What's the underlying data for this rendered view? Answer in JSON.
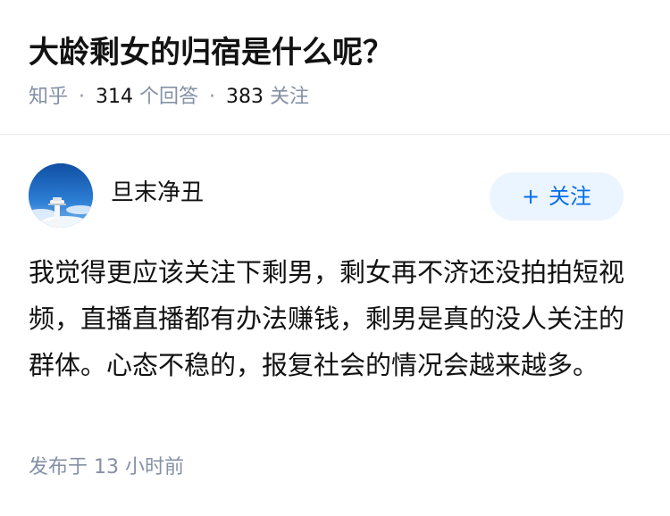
{
  "question": {
    "title": "大龄剩女的归宿是什么呢？",
    "site": "知乎",
    "answer_count": "314",
    "answer_label": "个回答",
    "follower_count": "383",
    "follower_label": "关注",
    "separator": "·"
  },
  "answer": {
    "author": {
      "name": "旦末净丑",
      "avatar_icon": "avatar-sky-tower"
    },
    "follow_button": {
      "icon": "+",
      "label": "关注"
    },
    "content": "我觉得更应该关注下剩男，剩女再不济还没拍拍短视频，直播直播都有办法赚钱，剩男是真的没人关注的群体。心态不稳的，报复社会的情况会越来越多。",
    "published": "发布于 13 小时前"
  },
  "colors": {
    "accent": "#056de8",
    "accent_bg": "#ebf5ff",
    "meta_text": "#8590a6",
    "primary_text": "#121212",
    "divider": "#ebebeb"
  }
}
